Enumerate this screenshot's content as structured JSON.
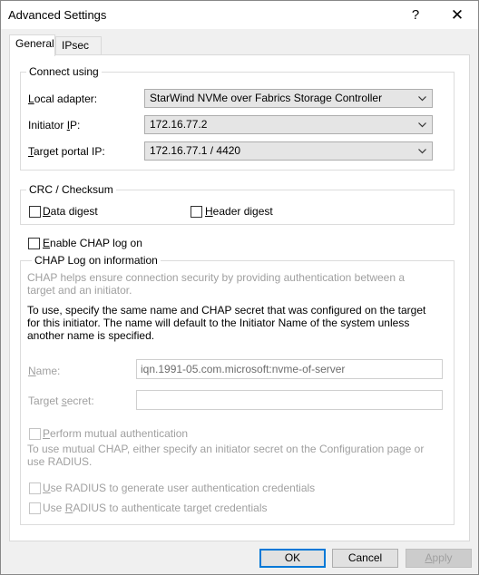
{
  "window": {
    "title": "Advanced Settings",
    "help_glyph": "?",
    "close_glyph": "✕"
  },
  "tabs": [
    {
      "label": "General",
      "active": true
    },
    {
      "label": "IPsec",
      "active": false
    }
  ],
  "connect_using": {
    "legend": "Connect using",
    "local_adapter": {
      "label_pre": "",
      "label_ul": "L",
      "label_post": "ocal adapter:",
      "value": "StarWind NVMe over Fabrics Storage Controller"
    },
    "initiator_ip": {
      "label_pre": "Initiator ",
      "label_ul": "I",
      "label_post": "P:",
      "value": "172.16.77.2"
    },
    "target_portal_ip": {
      "label_pre": "",
      "label_ul": "T",
      "label_post": "arget portal IP:",
      "value": "172.16.77.1 / 4420"
    }
  },
  "crc": {
    "legend": "CRC / Checksum",
    "data_digest": {
      "ul": "D",
      "rest": "ata digest",
      "checked": false
    },
    "header_digest": {
      "ul": "H",
      "rest": "eader digest",
      "checked": false
    }
  },
  "chap": {
    "enable": {
      "ul": "E",
      "rest": "nable CHAP log on",
      "checked": false
    },
    "legend": "CHAP Log on information",
    "help_text": "CHAP helps ensure connection security by providing authentication between a target and an initiator.",
    "instructions": "To use, specify the same name and CHAP secret that was configured on the target for this initiator.  The name will default to the Initiator Name of the system unless another name is specified.",
    "name": {
      "ul": "N",
      "rest": "ame:",
      "value": "iqn.1991-05.com.microsoft:nvme-of-server"
    },
    "target_secret": {
      "pre": "Target ",
      "ul": "s",
      "rest": "ecret:",
      "value": ""
    },
    "mutual": {
      "ul": "P",
      "rest": "erform mutual authentication",
      "checked": false
    },
    "mutual_help": "To use mutual CHAP, either specify an initiator secret on the Configuration page or use RADIUS.",
    "radius_generate": {
      "ul": "U",
      "rest": "se RADIUS to generate user authentication credentials",
      "checked": false
    },
    "radius_authenticate": {
      "pre": "Use ",
      "ul": "R",
      "rest": "ADIUS to authenticate target credentials",
      "checked": false
    }
  },
  "buttons": {
    "ok": "OK",
    "cancel": "Cancel",
    "apply_ul": "A",
    "apply_rest": "pply"
  }
}
